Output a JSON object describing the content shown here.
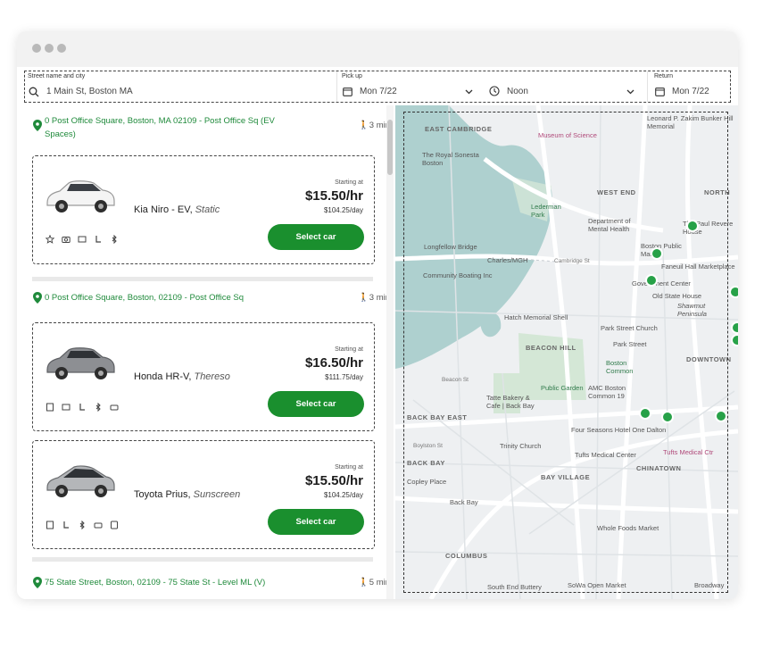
{
  "search": {
    "street_label": "Street name and city",
    "street_value": "1 Main St, Boston MA",
    "pickup_label": "Pick up",
    "pickup_date": "Mon 7/22",
    "pickup_time": "Noon",
    "return_label": "Return",
    "return_date": "Mon 7/22"
  },
  "locations": [
    {
      "address": "0 Post Office Square, Boston, MA 02109 - Post Office Sq (EV Spaces)",
      "walk": "3 min",
      "cars": [
        {
          "model": "Kia Niro - EV,",
          "nickname": "Static",
          "starting": "Starting at",
          "price": "$15.50/hr",
          "day": "$104.25/day",
          "button": "Select car"
        }
      ]
    },
    {
      "address": "0 Post Office Square, Boston, 02109 - Post Office Sq",
      "walk": "3 min",
      "cars": [
        {
          "model": "Honda HR-V,",
          "nickname": "Thereso",
          "starting": "Starting at",
          "price": "$16.50/hr",
          "day": "$111.75/day",
          "button": "Select car"
        },
        {
          "model": "Toyota Prius,",
          "nickname": "Sunscreen",
          "starting": "Starting at",
          "price": "$15.50/hr",
          "day": "$104.25/day",
          "button": "Select car"
        }
      ]
    },
    {
      "address": "75 State Street, Boston, 02109 - 75 State St - Level ML (V)",
      "walk": "5 min",
      "cars": []
    }
  ],
  "map": {
    "labels": {
      "east_cambridge": "EAST CAMBRIDGE",
      "royal_sonesta": "The Royal Sonesta Boston",
      "museum_science": "Museum of Science",
      "zakim": "Leonard P. Zakim Bunker Hill Memorial",
      "west_end": "WEST END",
      "north_end": "NORTH",
      "lederman": "Lederman Park",
      "mental_health": "Department of Mental Health",
      "paul_revere": "The Paul Revere House",
      "longfellow": "Longfellow Bridge",
      "charles_mgh": "Charles/MGH",
      "public_market": "Boston Public Market",
      "community_boating": "Community Boating Inc",
      "cambridge_st": "Cambridge St",
      "faneuil": "Faneuil Hall Marketplace",
      "gov_center": "Government Center",
      "old_state": "Old State House",
      "shawmut": "Shawmut Peninsula",
      "hatch": "Hatch Memorial Shell",
      "park_street": "Park Street Church",
      "beacon_hill": "BEACON HILL",
      "park_st": "Park Street",
      "downtown": "DOWNTOWN",
      "boston_common": "Boston Common",
      "public_garden": "Public Garden",
      "amc": "AMC Boston Common 19",
      "tatte": "Tatte Bakery & Cafe | Back Bay",
      "back_bay_east": "BACK BAY EAST",
      "four_seasons": "Four Seasons Hotel One Dalton",
      "trinity": "Trinity Church",
      "tufts_med": "Tufts Medical Center",
      "tufts_mc": "Tufts Medical Ctr",
      "chinatown": "CHINATOWN",
      "back_bay": "BACK BAY",
      "bay_village": "BAY VILLAGE",
      "copley": "Copley Place",
      "back_bay_st": "Back Bay",
      "whole_foods": "Whole Foods Market",
      "columbus": "COLUMBUS",
      "south_end": "South End Buttery",
      "sowa": "SoWa Open Market",
      "broadway": "Broadway",
      "beacon_st": "Beacon St",
      "boylston": "Boylston St"
    }
  },
  "colors": {
    "brand_green": "#1a8f2e",
    "link_green": "#1f8a3b",
    "pin_green": "#27a148"
  }
}
